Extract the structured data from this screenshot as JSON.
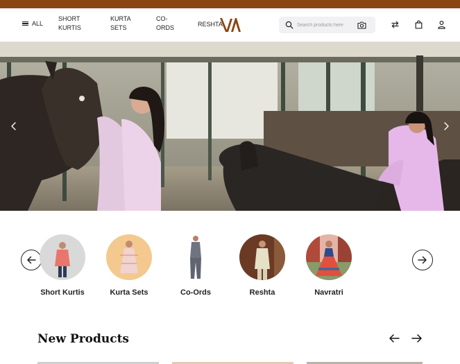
{
  "header": {
    "nav": {
      "all": "ALL",
      "short_kurtis": [
        "SHORT",
        "KURTIS"
      ],
      "kurta_sets": [
        "KURTA",
        "SETS"
      ],
      "co_ords": [
        "CO-",
        "ORDS"
      ],
      "reshta": "RESHTA"
    },
    "search": {
      "placeholder": "Search products here",
      "value": ""
    },
    "icons": [
      "compare-icon",
      "bag-icon",
      "user-icon"
    ]
  },
  "hero": {
    "slides_nav": [
      "prev",
      "next"
    ]
  },
  "categories": [
    {
      "label": "Short Kurtis",
      "bg": "#d9d9d9",
      "outfit": "#e8766c"
    },
    {
      "label": "Kurta Sets",
      "bg": "#f3c98f",
      "outfit": "#f1d3cf"
    },
    {
      "label": "Co-Ords",
      "bg": "#ffffff",
      "outfit": "#6f7480"
    },
    {
      "label": "Reshta",
      "bg": "#6b3a25",
      "outfit": "#e6e0c6"
    },
    {
      "label": "Navratri",
      "bg": "#e4b4a6",
      "outfit": "#e14f3e"
    }
  ],
  "new_products": {
    "title": "New Products"
  },
  "colors": {
    "brand": "#8b4513",
    "search_bg": "#f1f1f3"
  }
}
